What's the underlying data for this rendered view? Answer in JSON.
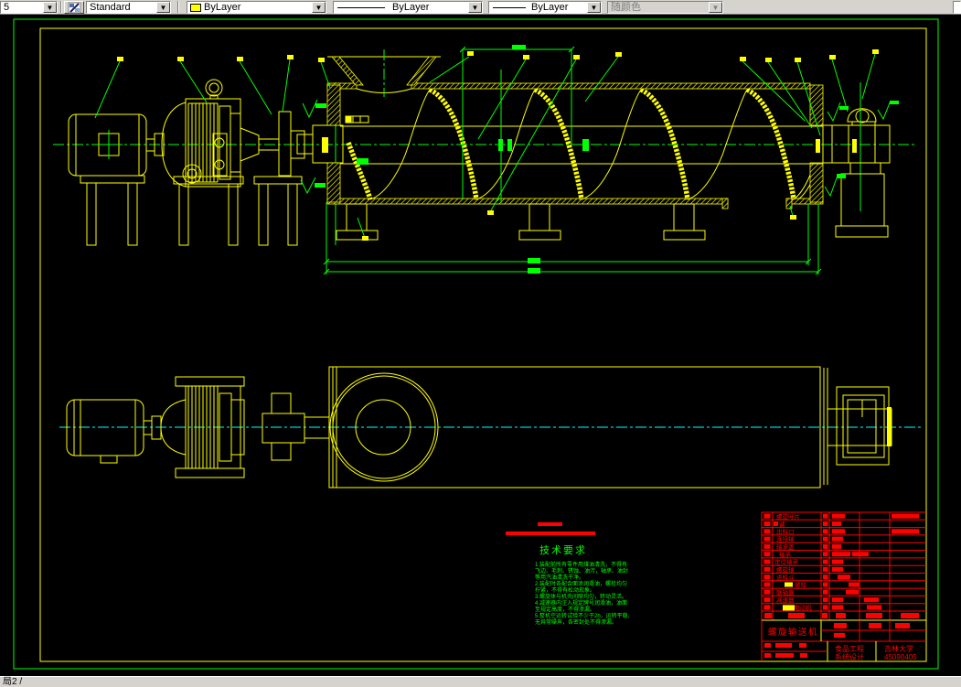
{
  "toolbar": {
    "layer_combo_value": "5",
    "style_combo_value": "Standard",
    "color_combo_value": "ByLayer",
    "color_swatch": "#ffff00",
    "linetype_combo_value": "ByLayer",
    "lineweight_combo_value": "ByLayer",
    "plotstyle_combo_value": "随颜色"
  },
  "statusbar": {
    "text": "局2 /"
  },
  "colors": {
    "cad_yellow": "#ffff00",
    "cad_green": "#00ff00",
    "cad_cyan": "#00ffff",
    "cad_red": "#ff0000"
  },
  "drawing": {
    "tech": {
      "title": "技术要求",
      "lines": [
        "1.装配前所有零件用煤油清洗，不得有",
        "飞边、毛刺、锈蚀、油污，轴承、油封",
        "等用汽油清洗干净。",
        "2.装配时各配合面涂润滑油，螺栓均匀",
        "拧紧，不得有松动现象。",
        "3.螺旋体与机壳间隙均匀，转动灵活。",
        "4.减速器内注入规定牌号润滑油，油面",
        "至规定高度，不得渗漏。",
        "5.整机空运转试验不少于2h，运转平稳,",
        "无异常噪声，各密封处不得渗漏。"
      ]
    },
    "title_block": {
      "parts": [
        "螺旋叶片",
        "键",
        "出料口",
        "连接轴",
        "轴承盖",
        "轴承",
        "定位轴承",
        "螺旋轴",
        "进料斗",
        "螺栓",
        "联轴器",
        "减速器",
        "电动机"
      ],
      "drawing_title": "螺旋输送机",
      "dept_line1": "食品工程",
      "dept_line2": "系统设计",
      "school_line1": "吉林大学",
      "school_line2": "45090405"
    }
  }
}
